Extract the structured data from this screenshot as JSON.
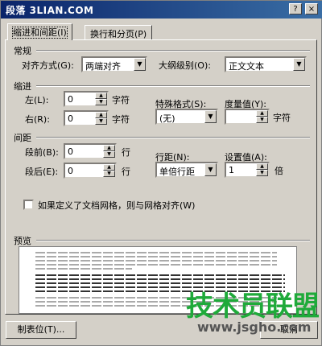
{
  "window": {
    "title": "段落  3LIAN.COM",
    "help_button": "?",
    "close_button": "×"
  },
  "tabs": [
    {
      "label": "缩进和间距(I)",
      "active": true
    },
    {
      "label": "换行和分页(P)",
      "active": false
    }
  ],
  "general": {
    "title": "常规",
    "alignment_label": "对齐方式(G):",
    "alignment_value": "两端对齐",
    "outline_label": "大纲级别(O):",
    "outline_value": "正文文本"
  },
  "indent": {
    "title": "缩进",
    "left_label": "左(L):",
    "left_value": "0",
    "left_unit": "字符",
    "right_label": "右(R):",
    "right_value": "0",
    "right_unit": "字符",
    "special_label": "特殊格式(S):",
    "special_value": "(无)",
    "measure_label": "度量值(Y):",
    "measure_value": "",
    "measure_unit": "字符"
  },
  "spacing": {
    "title": "间距",
    "before_label": "段前(B):",
    "before_value": "0",
    "before_unit": "行",
    "after_label": "段后(E):",
    "after_value": "0",
    "after_unit": "行",
    "line_label": "行距(N):",
    "line_value": "单倍行距",
    "setting_label": "设置值(A):",
    "setting_value": "1",
    "setting_unit": "倍"
  },
  "grid_checkbox": {
    "label": "如果定义了文档网格，则与网格对齐(W)",
    "checked": false
  },
  "preview": {
    "title": "预览"
  },
  "buttons": {
    "tabs_label": "制表位(T)...",
    "cancel_label": "取消"
  },
  "watermark": {
    "brand": "技术员联盟",
    "url": "www.jsgho.com"
  },
  "colors": {
    "titlebar": "#0a246a",
    "dialog_bg": "#d4d0c8",
    "watermark_green": "#1faa3a"
  }
}
